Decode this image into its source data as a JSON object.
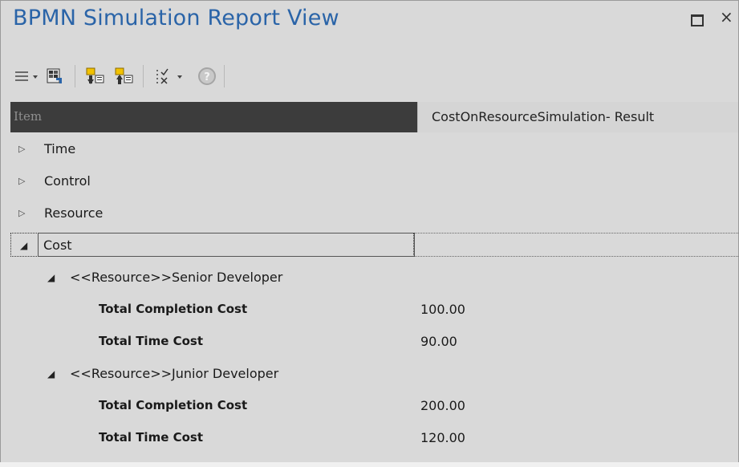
{
  "window": {
    "title": "BPMN Simulation Report View",
    "maximize_glyph": "",
    "close_glyph": "×"
  },
  "toolbar": {
    "icons": [
      "menu-icon",
      "dropdown-arrow-icon",
      "export-results-icon",
      "expand-all-icon",
      "collapse-all-icon",
      "options-icon",
      "dropdown-arrow-icon",
      "help-icon"
    ],
    "menu_glyph": "☰",
    "arrow_glyph": "▾",
    "help_glyph": "?"
  },
  "columns": {
    "item": "Item",
    "result": "CostOnResourceSimulation- Result"
  },
  "tree": {
    "collapsed_caret": "▷",
    "expanded_caret": "◢",
    "time": "Time",
    "control": "Control",
    "resource": "Resource",
    "cost": "Cost",
    "senior": {
      "label": "<<Resource>>Senior Developer",
      "completion_label": "Total Completion Cost",
      "completion_value": "100.00",
      "time_label": "Total Time Cost",
      "time_value": "90.00"
    },
    "junior": {
      "label": "<<Resource>>Junior Developer",
      "completion_label": "Total Completion Cost",
      "completion_value": "200.00",
      "time_label": "Total Time Cost",
      "time_value": "120.00"
    }
  },
  "colors": {
    "title": "#2a64a8",
    "header_dark": "#3c3c3c",
    "background": "#d9d9d9"
  }
}
